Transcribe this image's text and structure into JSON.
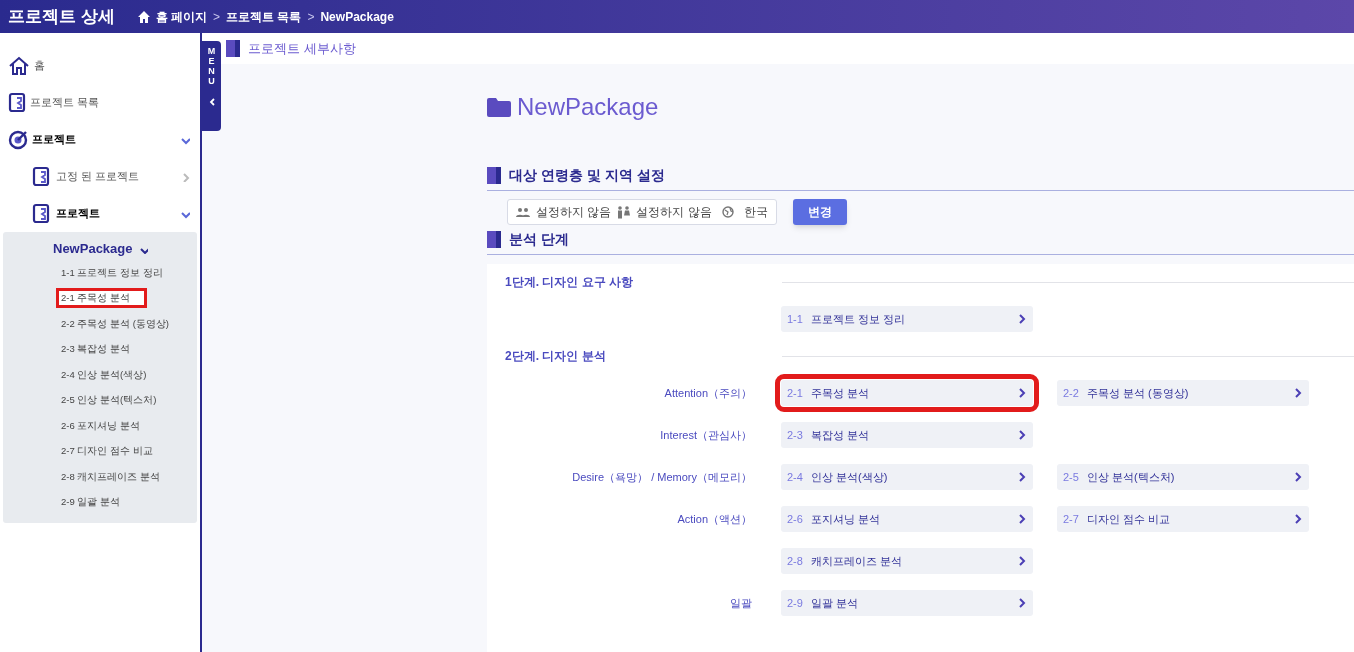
{
  "header": {
    "title": "프로젝트 상세",
    "breadcrumb": [
      "홈 페이지",
      "프로젝트 목록",
      "NewPackage"
    ],
    "separator": ">"
  },
  "sidebar": {
    "items": [
      {
        "label": "홈"
      },
      {
        "label": "프로젝트 목록"
      },
      {
        "label": "프로젝트",
        "expanded": true,
        "children": [
          {
            "label": "고정 된 프로젝트",
            "expanded": false
          },
          {
            "label": "프로젝트",
            "expanded": true,
            "children": [
              {
                "label": "NewPackage",
                "expanded": true,
                "children": [
                  {
                    "label": "1-1 프로젝트 정보 정리",
                    "highlighted": false
                  },
                  {
                    "label": "2-1 주목성 분석",
                    "highlighted": true
                  },
                  {
                    "label": "2-2 주목성 분석 (동영상)",
                    "highlighted": false
                  },
                  {
                    "label": "2-3 복잡성 분석",
                    "highlighted": false
                  },
                  {
                    "label": "2-4 인상 분석(색상)",
                    "highlighted": false
                  },
                  {
                    "label": "2-5 인상 분석(텍스처)",
                    "highlighted": false
                  },
                  {
                    "label": "2-6 포지셔닝 분석",
                    "highlighted": false
                  },
                  {
                    "label": "2-7 디자인 점수 비교",
                    "highlighted": false
                  },
                  {
                    "label": "2-8 캐치프레이즈 분석",
                    "highlighted": false
                  },
                  {
                    "label": "2-9 일괄 분석",
                    "highlighted": false
                  }
                ]
              }
            ]
          }
        ]
      }
    ]
  },
  "menu_tab": {
    "label": "MENU"
  },
  "page_title": "프로젝트 세부사항",
  "project_name": "NewPackage",
  "target_section": {
    "title": "대상 연령층 및 지역 설정",
    "age": "설정하지 않음",
    "gender": "설정하지 않음",
    "region": "한국",
    "button": "변경"
  },
  "analysis_section": {
    "title": "분석 단계",
    "stages": [
      {
        "title": "1단계. 디자인 요구 사항",
        "rows": [
          {
            "items": [
              {
                "number": "1-1",
                "label": "프로젝트 정보 정리",
                "highlighted": false
              }
            ]
          }
        ]
      },
      {
        "title": "2단계. 디자인 분석",
        "rows": [
          {
            "label": "Attention（주의）",
            "items": [
              {
                "number": "2-1",
                "label": "주목성 분석",
                "highlighted": true
              },
              {
                "number": "2-2",
                "label": "주목성 분석 (동영상)",
                "highlighted": false
              }
            ]
          },
          {
            "label": "Interest（관심사）",
            "items": [
              {
                "number": "2-3",
                "label": "복잡성 분석",
                "highlighted": false
              }
            ]
          },
          {
            "label": "Desire（욕망） / Memory（메모리）",
            "items": [
              {
                "number": "2-4",
                "label": "인상 분석(색상)",
                "highlighted": false
              },
              {
                "number": "2-5",
                "label": "인상 분석(텍스처)",
                "highlighted": false
              }
            ]
          },
          {
            "label": "Action（액션）",
            "items": [
              {
                "number": "2-6",
                "label": "포지셔닝 분석",
                "highlighted": false
              },
              {
                "number": "2-7",
                "label": "디자인 점수 비교",
                "highlighted": false
              }
            ]
          },
          {
            "items": [
              {
                "number": "2-8",
                "label": "캐치프레이즈 분석",
                "highlighted": false
              }
            ]
          },
          {
            "label": "일괄",
            "items": [
              {
                "number": "2-9",
                "label": "일괄 분석",
                "highlighted": false
              }
            ]
          }
        ]
      }
    ]
  }
}
